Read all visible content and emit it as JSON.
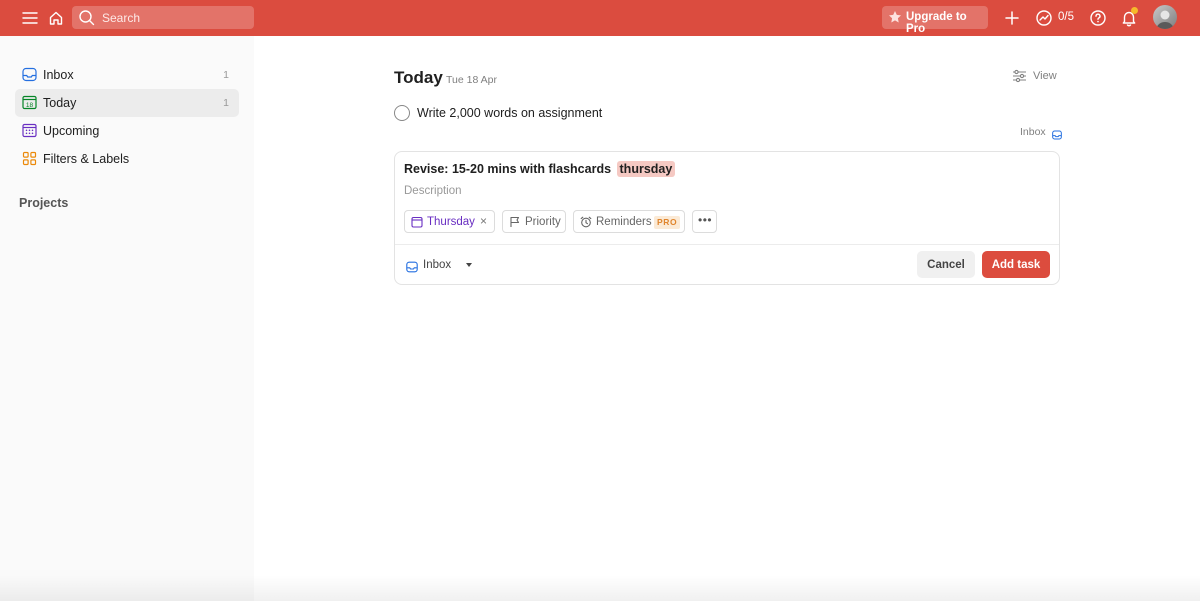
{
  "topbar": {
    "search_placeholder": "Search",
    "upgrade_label": "Upgrade to Pro",
    "karma": "0/5",
    "icons": [
      "menu-icon",
      "home-icon",
      "search-icon",
      "star-icon",
      "plus-icon",
      "productivity-icon",
      "help-icon",
      "bell-icon"
    ],
    "accent_color": "#db4c3f"
  },
  "sidebar": {
    "items": [
      {
        "label": "Inbox",
        "count": "1",
        "icon": "inbox-icon"
      },
      {
        "label": "Today",
        "count": "1",
        "icon": "calendar-today-icon",
        "day": "18"
      },
      {
        "label": "Upcoming",
        "icon": "calendar-upcoming-icon"
      },
      {
        "label": "Filters & Labels",
        "icon": "filters-icon"
      }
    ],
    "projects_heading": "Projects"
  },
  "main": {
    "title": "Today",
    "date": "Tue 18 Apr",
    "view_label": "View",
    "task": {
      "text": "Write 2,000 words on assignment",
      "project": "Inbox"
    }
  },
  "editor": {
    "title": "Revise: 15-20 mins with flashcards",
    "highlight": "thursday",
    "description_placeholder": "Description",
    "chips": {
      "date": "Thursday",
      "priority": "Priority",
      "reminders": "Reminders",
      "pro_badge": "PRO",
      "more": "•••"
    },
    "project": "Inbox",
    "cancel_label": "Cancel",
    "add_label": "Add task"
  }
}
